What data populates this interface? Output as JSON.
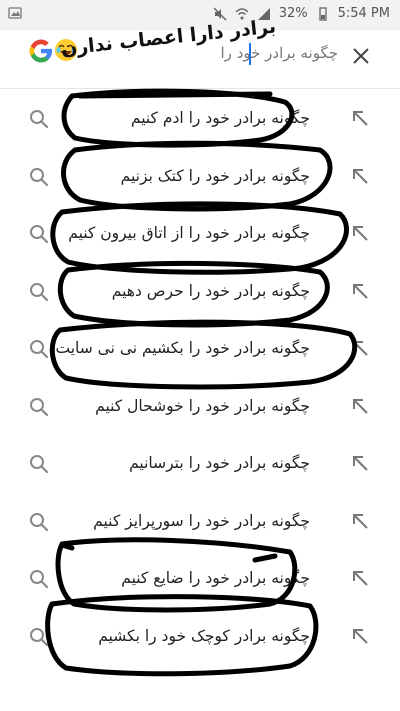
{
  "status_bar": {
    "battery_pct": "32%",
    "time": "5:54 PM"
  },
  "search": {
    "query": "چگونه برادر خود را"
  },
  "overlay_caption": "برادر دارا اعصاب ندارن",
  "suggestions": [
    {
      "text": "چگونه برادر خود را ادم کنیم"
    },
    {
      "text": "چگونه برادر خود را کتک بزنیم"
    },
    {
      "text": "چگونه برادر خود را از اتاق بیرون کنیم"
    },
    {
      "text": "چگونه برادر خود را حرص دهیم"
    },
    {
      "text": "چگونه برادر خود را بکشیم نی نی سایت"
    },
    {
      "text": "چگونه برادر خود را خوشحال کنیم"
    },
    {
      "text": "چگونه برادر خود را بترسانیم"
    },
    {
      "text": "چگونه برادر خود را سورپرایز کنیم"
    },
    {
      "text": "چگونه برادر خود را ضایع کنیم"
    },
    {
      "text": "چگونه برادر کوچک خود را بکشیم"
    }
  ],
  "icons": {
    "suggestion_left": "search-icon",
    "suggestion_right": "fill-query-arrow-icon"
  },
  "colors": {
    "background": "#ffffff",
    "statusbar": "#f2f2f2",
    "caret": "#1a73e8",
    "scribble": "#000000"
  }
}
